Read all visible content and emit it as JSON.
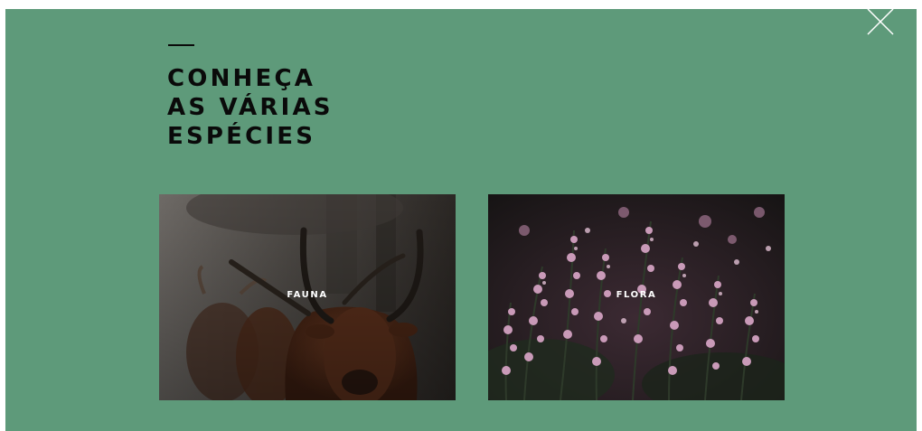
{
  "modal": {
    "background": "#5e9a7a",
    "close_icon": "close-icon"
  },
  "heading": {
    "lines": [
      "CONHEÇA",
      "AS VÁRIAS",
      "ESPÉCIES"
    ]
  },
  "cards": [
    {
      "label": "FAUNA",
      "image": "longhorn-cattle-photo"
    },
    {
      "label": "FLORA",
      "image": "heather-flowers-photo"
    }
  ]
}
